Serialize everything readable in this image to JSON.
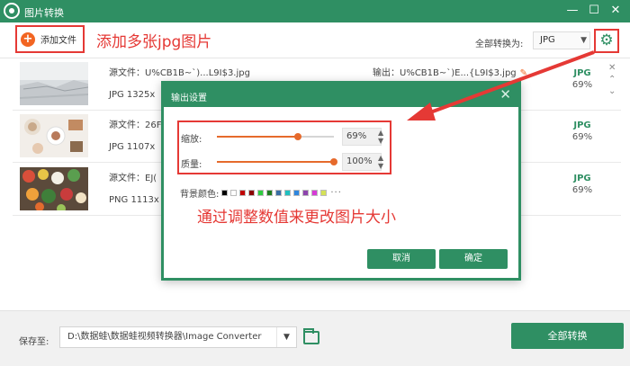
{
  "app": {
    "title": "图片转换"
  },
  "window_controls": {
    "minimize": "—",
    "maximize": "☐",
    "close": "✕"
  },
  "toolbar": {
    "add_file_label": "添加文件",
    "convert_all_to_label": "全部转换为:",
    "format_value": "JPG"
  },
  "annotations": {
    "add_jpg": "添加多张jpg图片",
    "adjust_values": "通过调整数值来更改图片大小"
  },
  "files": [
    {
      "source": "源文件：U%CB1B~`)...L9I$3.jpg",
      "meta": "JPG  1325x",
      "output": "输出：U%CB1B~`)E...{L9I$3.jpg",
      "format": "JPG",
      "quality": "69%"
    },
    {
      "source": "源文件：26F",
      "meta": "JPG  1107x",
      "output": "",
      "format": "JPG",
      "quality": "69%"
    },
    {
      "source": "源文件：EJ(",
      "meta": "PNG  1113x",
      "output": "",
      "format": "JPG",
      "quality": "69%"
    }
  ],
  "modal": {
    "title": "输出设置",
    "scale_label": "缩放:",
    "scale_value": "69%",
    "scale_level": 0.69,
    "quality_label": "质量:",
    "quality_value": "100%",
    "quality_level": 1.0,
    "bg_label": "背景颜色:",
    "bg_more": "···",
    "bg_colors": [
      "#000000",
      "#ffffff",
      "#c00000",
      "#8b0000",
      "#2ecc40",
      "#1e7b1e",
      "#3a6ea5",
      "#20c0c0",
      "#2e86de",
      "#8e44ad",
      "#d63ad6",
      "#d4e157"
    ],
    "cancel_label": "取消",
    "ok_label": "确定"
  },
  "bottom": {
    "save_label": "保存至:",
    "save_path": "D:\\数据蛙\\数据蛙视频转换器\\Image Converter",
    "convert_all_label": "全部转换"
  },
  "colors": {
    "accent": "#2f8f63",
    "annotation": "#e53935",
    "slider": "#e66a2c"
  }
}
